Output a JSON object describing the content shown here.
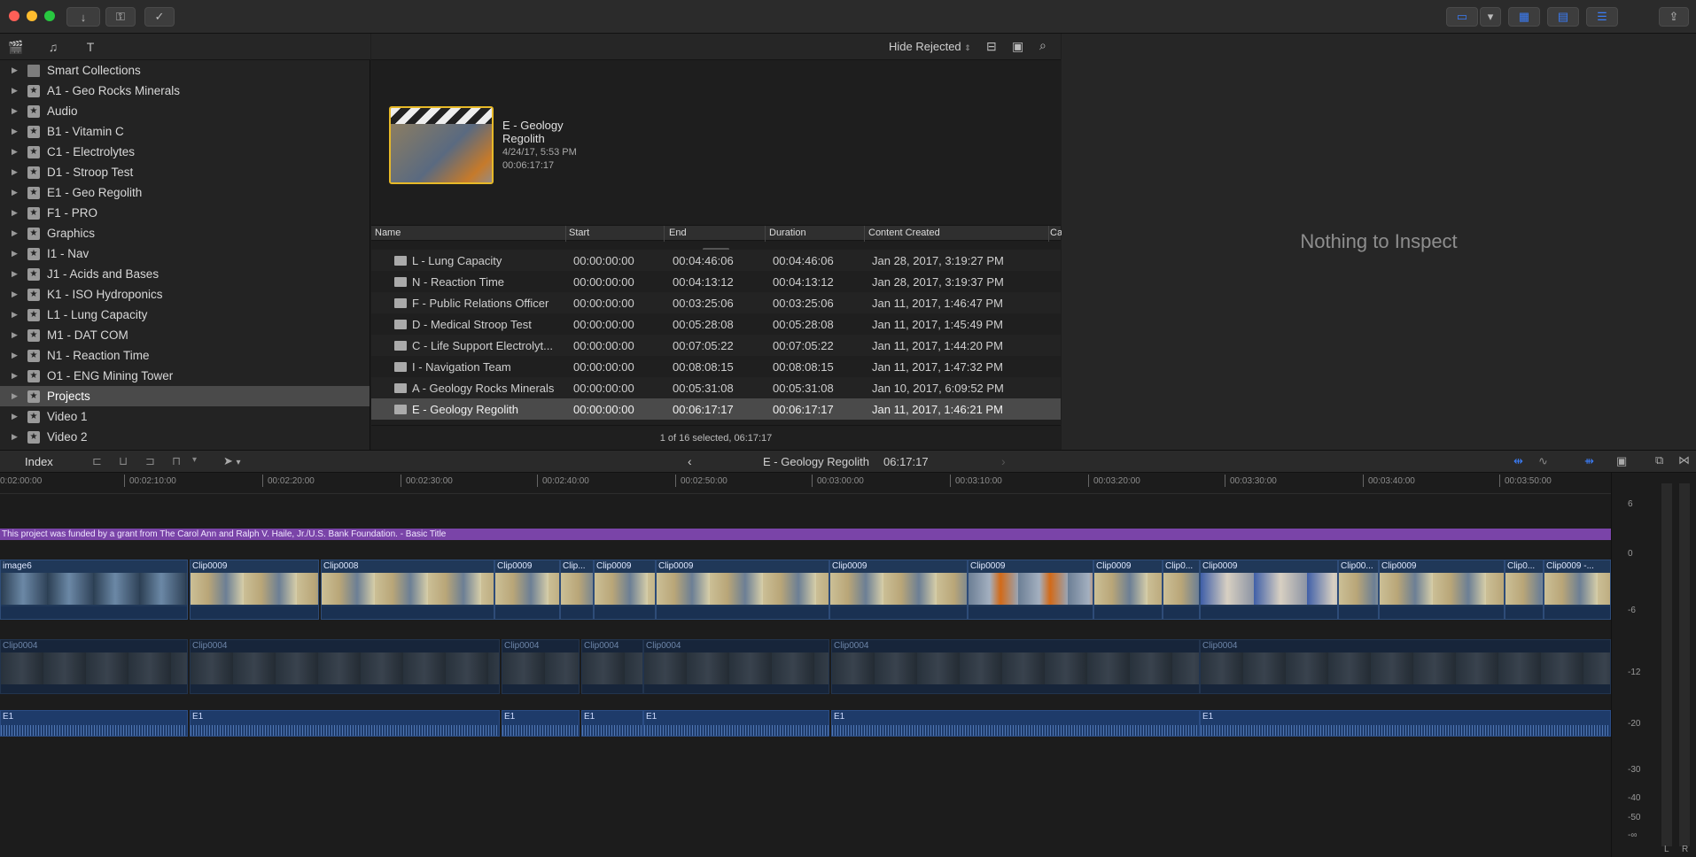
{
  "browser": {
    "filter_label": "Hide Rejected",
    "event": {
      "title": "E - Geology Regolith",
      "date": "4/24/17, 5:53 PM",
      "duration": "00:06:17:17"
    },
    "columns": [
      "Name",
      "Start",
      "End",
      "Duration",
      "Content Created",
      "Ca"
    ],
    "rows": [
      {
        "name": "L - Lung Capacity",
        "start": "00:00:00:00",
        "end": "00:04:46:06",
        "duration": "00:04:46:06",
        "created": "Jan 28, 2017, 3:19:27 PM"
      },
      {
        "name": "N - Reaction Time",
        "start": "00:00:00:00",
        "end": "00:04:13:12",
        "duration": "00:04:13:12",
        "created": "Jan 28, 2017, 3:19:37 PM"
      },
      {
        "name": "F - Public Relations Officer",
        "start": "00:00:00:00",
        "end": "00:03:25:06",
        "duration": "00:03:25:06",
        "created": "Jan 11, 2017, 1:46:47 PM"
      },
      {
        "name": "D - Medical Stroop Test",
        "start": "00:00:00:00",
        "end": "00:05:28:08",
        "duration": "00:05:28:08",
        "created": "Jan 11, 2017, 1:45:49 PM"
      },
      {
        "name": "C - Life Support Electrolyt...",
        "start": "00:00:00:00",
        "end": "00:07:05:22",
        "duration": "00:07:05:22",
        "created": "Jan 11, 2017, 1:44:20 PM"
      },
      {
        "name": "I - Navigation Team",
        "start": "00:00:00:00",
        "end": "00:08:08:15",
        "duration": "00:08:08:15",
        "created": "Jan 11, 2017, 1:47:32 PM"
      },
      {
        "name": "A - Geology Rocks Minerals",
        "start": "00:00:00:00",
        "end": "00:05:31:08",
        "duration": "00:05:31:08",
        "created": "Jan 10, 2017, 6:09:52 PM"
      },
      {
        "name": "E - Geology Regolith",
        "start": "00:00:00:00",
        "end": "00:06:17:17",
        "duration": "00:06:17:17",
        "created": "Jan 11, 2017, 1:46:21 PM"
      }
    ],
    "status": "1 of 16 selected, 06:17:17"
  },
  "sidebar": {
    "items": [
      {
        "label": "Smart Collections"
      },
      {
        "label": "A1 - Geo Rocks Minerals"
      },
      {
        "label": "Audio"
      },
      {
        "label": "B1 - Vitamin C"
      },
      {
        "label": "C1 - Electrolytes"
      },
      {
        "label": "D1 - Stroop Test"
      },
      {
        "label": "E1 - Geo Regolith"
      },
      {
        "label": "F1 - PRO"
      },
      {
        "label": "Graphics"
      },
      {
        "label": "I1 - Nav"
      },
      {
        "label": "J1 - Acids and Bases"
      },
      {
        "label": "K1 - ISO Hydroponics"
      },
      {
        "label": "L1 - Lung Capacity"
      },
      {
        "label": "M1 - DAT COM"
      },
      {
        "label": "N1 - Reaction Time"
      },
      {
        "label": "O1 - ENG Mining Tower"
      },
      {
        "label": "Projects"
      },
      {
        "label": "Video 1"
      },
      {
        "label": "Video 2"
      }
    ]
  },
  "inspector": {
    "message": "Nothing to Inspect"
  },
  "timeline": {
    "index_label": "Index",
    "project_name": "E - Geology Regolith",
    "project_duration": "06:17:17",
    "ruler": [
      "0:02:00:00",
      "00:02:10:00",
      "00:02:20:00",
      "00:02:30:00",
      "00:02:40:00",
      "00:02:50:00",
      "00:03:00:00",
      "00:03:10:00",
      "00:03:20:00",
      "00:03:30:00",
      "00:03:40:00",
      "00:03:50:00"
    ],
    "title_text": "This project was funded by a grant from The Carol Ann and Ralph V. Haile, Jr./U.S. Bank Foundation. - Basic Title",
    "primary_clips": [
      "image6",
      "Clip0009",
      "Clip0008",
      "Clip0009",
      "Clip...",
      "Clip0009",
      "Clip0009",
      "Clip0009",
      "Clip0009",
      "Clip0009",
      "Clip0...",
      "Clip0009",
      "Clip00...",
      "Clip0009",
      "Clip0...",
      "Clip0009 -..."
    ],
    "secondary_clips": [
      "Clip0004",
      "Clip0004",
      "Clip0004",
      "Clip0004",
      "Clip0004",
      "Clip0004",
      "Clip0004"
    ],
    "audio_clips": [
      "E1",
      "E1",
      "E1",
      "E1",
      "E1",
      "E1",
      "E1"
    ]
  },
  "meter": {
    "levels": [
      "6",
      "0",
      "-6",
      "-12",
      "-20",
      "-30",
      "-40",
      "-50",
      "-∞"
    ],
    "channels": [
      "L",
      "R"
    ]
  },
  "colors": {
    "accent": "#3b7cf5",
    "title_bar": "#7a44a8",
    "selection": "#e7b928"
  }
}
